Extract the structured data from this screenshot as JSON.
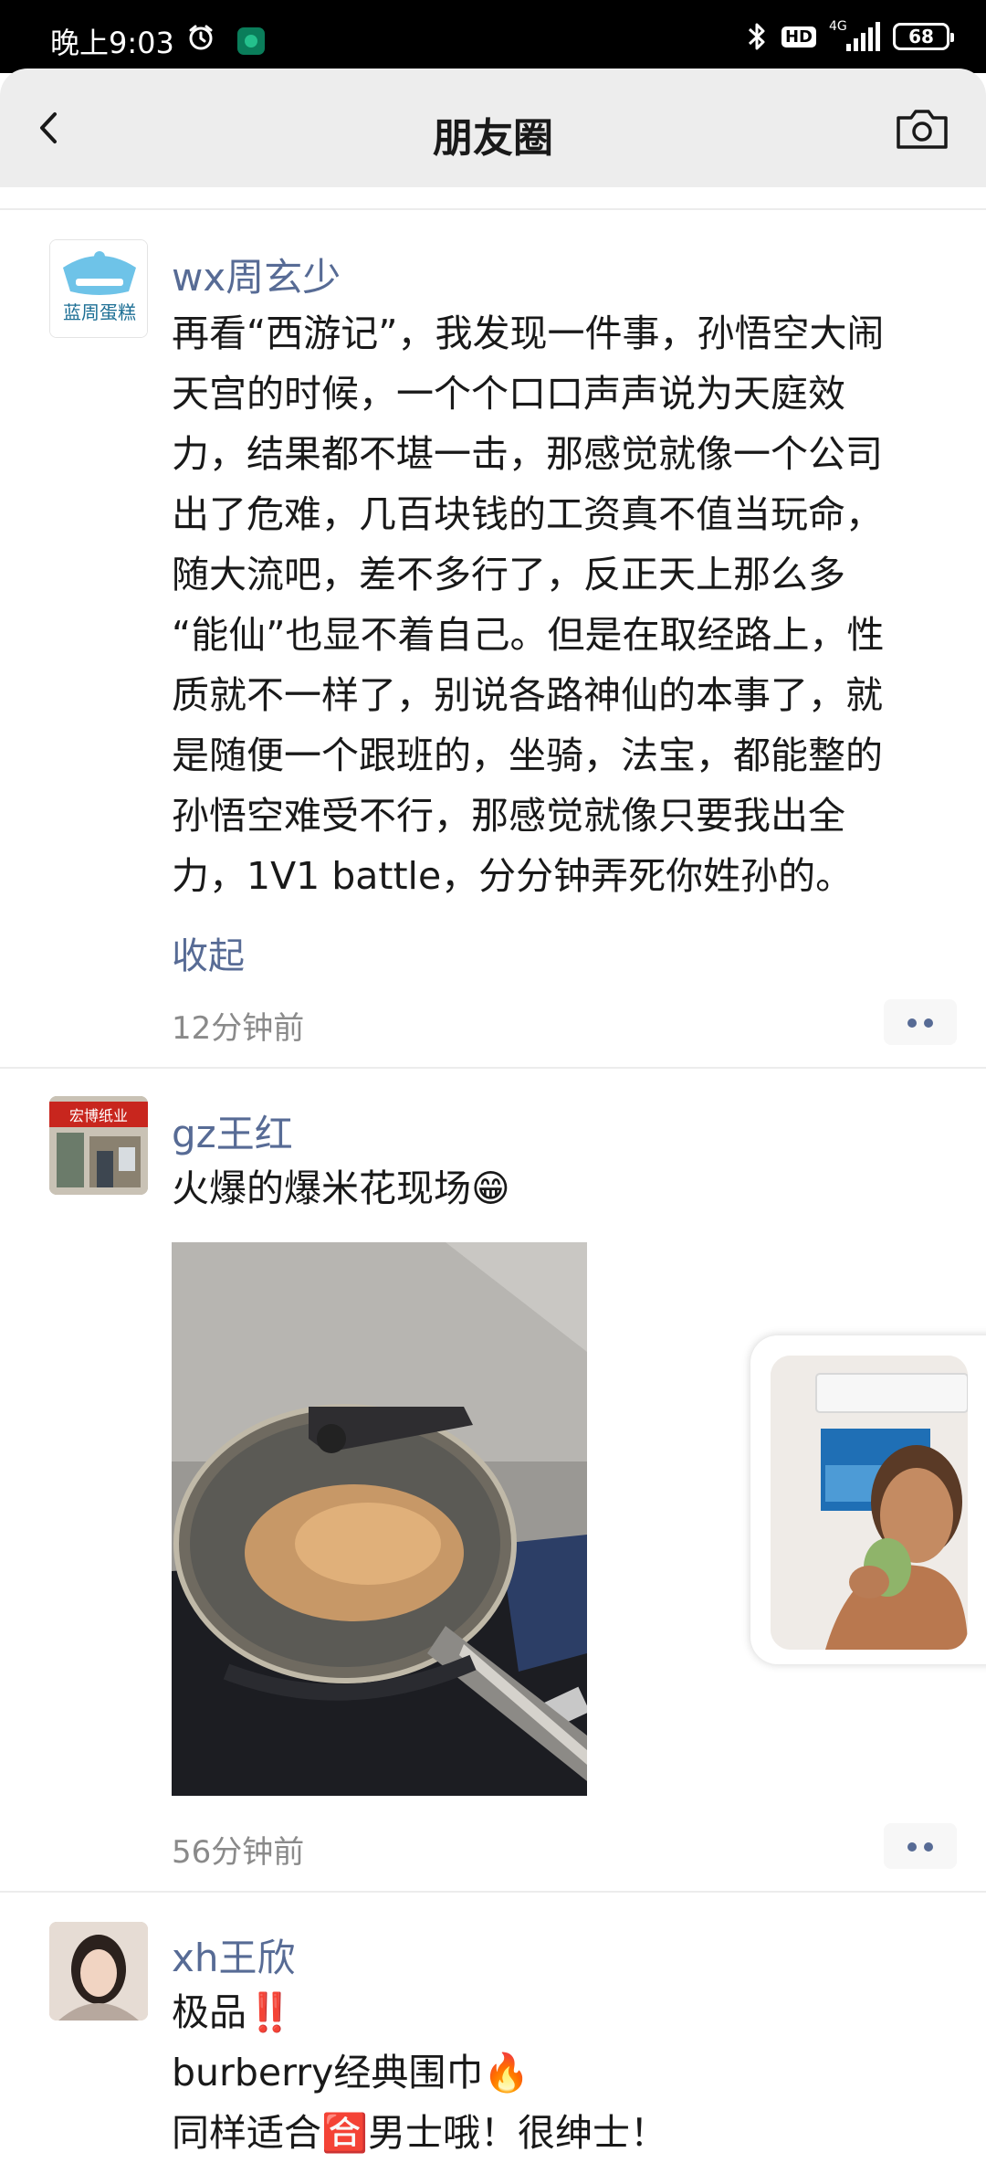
{
  "status_bar": {
    "time": "晚上9:03",
    "hd_badge": "HD",
    "network": "4G",
    "battery": "68"
  },
  "nav": {
    "title": "朋友圈"
  },
  "posts": [
    {
      "author": "wx周玄少",
      "avatar_caption": "蓝周蛋糕",
      "text_lines": [
        "再看“西游记”，我发现一件事，孙悟空大闹",
        "天宫的时候，一个个口口声声说为天庭效",
        "力，结果都不堪一击，那感觉就像一个公司",
        "出了危难，几百块钱的工资真不值当玩命，",
        "随大流吧，差不多行了，反正天上那么多",
        "“能仙”也显不着自己。但是在取经路上，性",
        "质就不一样了，别说各路神仙的本事了，就",
        "是随便一个跟班的，坐骑，法宝，都能整的",
        "孙悟空难受不行，那感觉就像只要我出全",
        "力，1V1 battle，分分钟弄死你姓孙的。"
      ],
      "collapse_label": "收起",
      "time": "12分钟前"
    },
    {
      "author": "gz王红",
      "avatar_caption": "宏博纸业",
      "text_lines": [
        "火爆的爆米花现场😁"
      ],
      "time": "56分钟前"
    },
    {
      "author": "xh王欣",
      "text_lines": [
        "极品‼️",
        "burberry经典围巾🔥",
        "同样适合🈴男士哦！很绅士！"
      ]
    }
  ],
  "colors": {
    "link_blue": "#576b95",
    "nav_bg": "#ededed",
    "text": "#191919",
    "meta_gray": "#8a8a8a"
  },
  "icons": {
    "back": "chevron-left-icon",
    "camera": "camera-icon",
    "alarm": "alarm-clock-icon",
    "bluetooth": "bluetooth-icon",
    "more": "more-dots-icon"
  }
}
